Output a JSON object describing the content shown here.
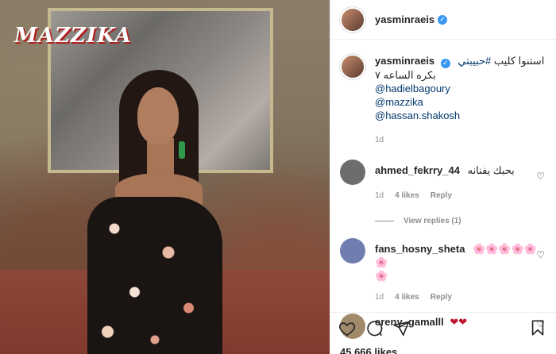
{
  "post": {
    "username": "yasminraeis",
    "caption_lines": [
      "استنوا كليب #حبيبتي",
      "بكره الساعه ٧"
    ],
    "caption_hashtag_prefix": "استنوا كليب ",
    "caption_hashtag": "#حبيبتي",
    "caption_line2": "بكره الساعه ٧",
    "mentions": [
      "@hadielbagoury",
      "@mazzika",
      "@hassan.shakosh"
    ],
    "time": "1d",
    "logo_text": "MAZZIKA"
  },
  "comments": [
    {
      "username": "ahmed_fekrry_44",
      "text": "بحبك يفنانه",
      "time": "1d",
      "likes": "4 likes",
      "reply": "Reply",
      "avatar_color": "#6d6d6d",
      "view_replies": "View replies (1)"
    },
    {
      "username": "fans_hosny_sheta",
      "text": "🌸🌸🌸🌸🌸🌸",
      "text2": "🌸",
      "time": "1d",
      "likes": "4 likes",
      "reply": "Reply",
      "avatar_color": "#6f7db0"
    },
    {
      "username": "ereny_gamalll",
      "text": "❤❤",
      "avatar_color": "#a08a6a"
    }
  ],
  "actions": {
    "likes_count": "45,666 likes",
    "icons": [
      "heart-icon",
      "comment-icon",
      "share-icon",
      "bookmark-icon"
    ]
  },
  "colors": {
    "link": "#00376b",
    "verified": "#3897f0",
    "muted": "#8e8e8e"
  }
}
